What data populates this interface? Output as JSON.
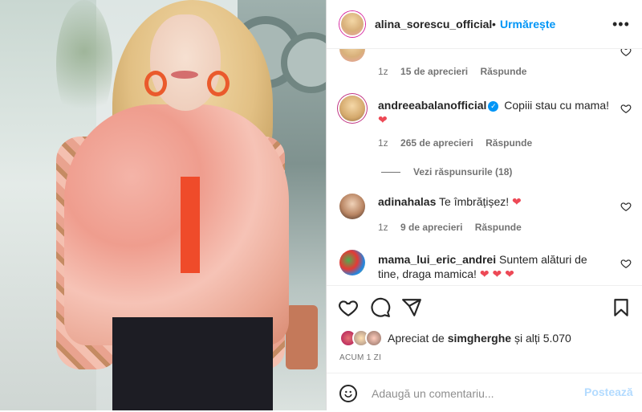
{
  "header": {
    "username": "alina_sorescu_official",
    "separator": "•",
    "follow_label": "Urmărește",
    "more_label": "•••"
  },
  "comments": [
    {
      "username": "",
      "text": "",
      "time": "1z",
      "likes": "15 de aprecieri",
      "reply_label": "Răspunde",
      "partially_visible": true
    },
    {
      "username": "andreeabalanofficial",
      "verified": true,
      "text": "Copiii stau cu mama!",
      "emoji": "❤",
      "time": "1z",
      "likes": "265 de aprecieri",
      "reply_label": "Răspunde",
      "view_replies": "Vezi răspunsurile (18)"
    },
    {
      "username": "adinahalas",
      "text": "Te îmbrățișez!",
      "emoji": "❤",
      "time": "1z",
      "likes": "9 de aprecieri",
      "reply_label": "Răspunde"
    },
    {
      "username": "mama_lui_eric_andrei",
      "text": "Suntem alături de tine, draga mamica!",
      "emoji": "❤ ❤ ❤"
    }
  ],
  "actions": {
    "icons": [
      "heart-icon",
      "comment-icon",
      "share-icon",
      "bookmark-icon"
    ]
  },
  "liked_by": {
    "prefix": "Apreciat de",
    "user": "simgherghe",
    "suffix": "și alți 5.070"
  },
  "timestamp": "ACUM 1 ZI",
  "add_comment": {
    "placeholder": "Adaugă un comentariu...",
    "post_label": "Postează"
  },
  "colors": {
    "accent": "#0095f6",
    "post_disabled": "#b3dbff",
    "heart": "#ed4956",
    "text": "#262626",
    "muted": "#737373"
  }
}
